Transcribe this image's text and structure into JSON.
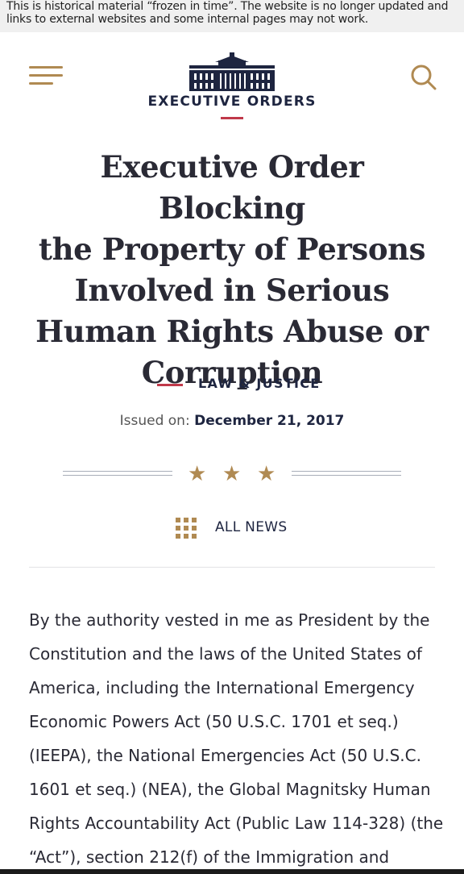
{
  "banner": {
    "line1": "This is historical material “frozen in time”. The website is no longer updated and",
    "line2": "links to external websites and some internal pages may not work."
  },
  "header": {
    "section": "EXECUTIVE ORDERS",
    "menu_icon": "hamburger-menu-icon",
    "search_icon": "search-icon",
    "logo_icon": "white-house-icon",
    "accent_color": "#b08a52",
    "rule_color": "#c0394a"
  },
  "article": {
    "title_lines": [
      "Executive Order Blocking",
      "the Property of Persons",
      "Involved in Serious",
      "Human Rights Abuse or",
      "Corruption"
    ],
    "category": "LAW & JUSTICE",
    "issued_label": "Issued on:",
    "issued_date": "December 21, 2017",
    "stars": [
      "★",
      "★",
      "★"
    ],
    "all_news": "ALL NEWS",
    "body_lines": [
      "By the authority vested in me as President by the",
      "Constitution and the laws of the United States of",
      "America, including the International Emergency",
      "Economic Powers Act (50 U.S.C. 1701 et seq.)",
      "(IEEPA), the National Emergencies Act (50 U.S.C.",
      "1601 et seq.) (NEA), the Global Magnitsky Human",
      "Rights Accountability Act (Public Law 114-328) (the",
      "“Act”), section 212(f) of the Immigration and"
    ]
  }
}
